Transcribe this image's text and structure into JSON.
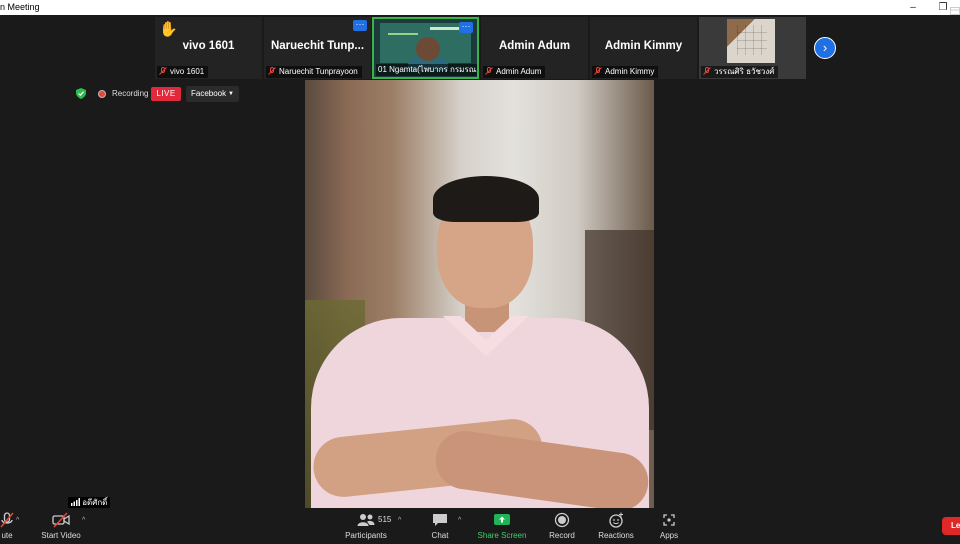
{
  "window": {
    "title": "n Meeting",
    "minimize_icon": "–",
    "restore_icon": "❐"
  },
  "participants_strip": [
    {
      "name": "vivo 1601",
      "label": "vivo 1601",
      "hand_raised": true
    },
    {
      "name": "Naruechit  Tunp...",
      "label": "Naruechit Tunprayoon",
      "more": "···"
    },
    {
      "name": "",
      "label": "01 Ngamta(ไพบากร กรมรณ...",
      "more": "···",
      "video": true
    },
    {
      "name": "Admin Adum",
      "label": "Admin Adum"
    },
    {
      "name": "Admin Kimmy",
      "label": "Admin Kimmy"
    },
    {
      "name": "",
      "label": "วรรณศิริ  ธวัชวงศ์",
      "photo": true
    }
  ],
  "next_page_icon": "›",
  "status": {
    "recording_label": "Recording",
    "live_badge": "LIVE",
    "stream_target": "Facebook",
    "stream_caret": "▼"
  },
  "speaker_label": "อดีศักดิ์",
  "toolbar": {
    "mute_label": "ute",
    "start_video_label": "Start Video",
    "participants_label": "Participants",
    "participants_count": "515",
    "chat_label": "Chat",
    "share_screen_label": "Share Screen",
    "record_label": "Record",
    "reactions_label": "Reactions",
    "apps_label": "Apps",
    "leave_label": "Le",
    "caret": "^"
  },
  "colors": {
    "accent_blue": "#1f6fe5",
    "live_red": "#e02a3c",
    "share_green": "#1fb556",
    "leave_red": "#e02828"
  }
}
